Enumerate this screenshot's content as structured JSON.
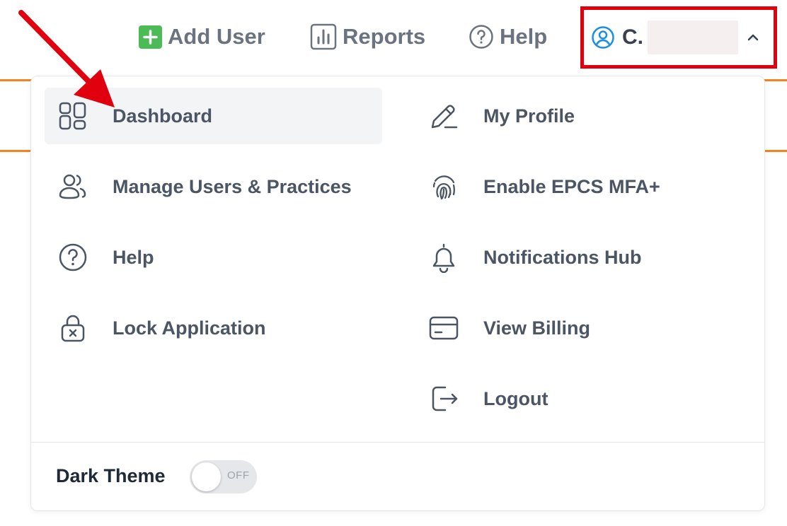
{
  "topnav": {
    "add_user": "Add User",
    "reports": "Reports",
    "help": "Help",
    "user_initial": "C."
  },
  "menu": {
    "left": [
      {
        "label": "Dashboard",
        "icon": "dashboard-icon",
        "active": true
      },
      {
        "label": "Manage Users & Practices",
        "icon": "users-icon"
      },
      {
        "label": "Help",
        "icon": "help-circle-icon"
      },
      {
        "label": "Lock Application",
        "icon": "lock-icon"
      }
    ],
    "right": [
      {
        "label": "My Profile",
        "icon": "pencil-icon"
      },
      {
        "label": "Enable EPCS MFA+",
        "icon": "fingerprint-icon"
      },
      {
        "label": "Notifications Hub",
        "icon": "bell-icon"
      },
      {
        "label": "View Billing",
        "icon": "credit-card-icon"
      },
      {
        "label": "Logout",
        "icon": "logout-icon"
      }
    ]
  },
  "footer": {
    "dark_theme_label": "Dark Theme",
    "toggle_state": "OFF"
  },
  "colors": {
    "accent_orange": "#f5821f",
    "highlight_red": "#e0000e",
    "add_green": "#4cbb55",
    "user_blue": "#1a8fe3",
    "text": "#4b5563"
  }
}
